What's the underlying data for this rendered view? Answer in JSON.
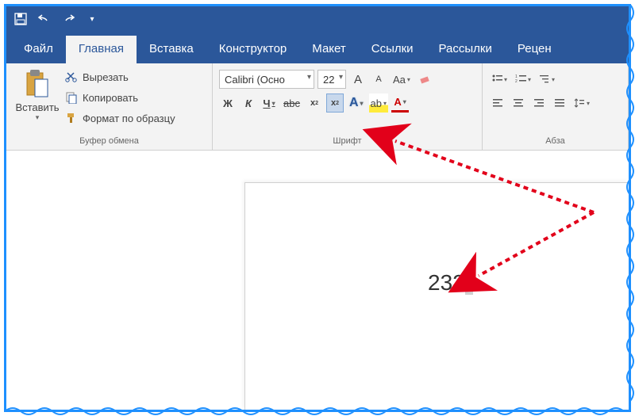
{
  "tabs": {
    "file": "Файл",
    "home": "Главная",
    "insert": "Вставка",
    "design": "Конструктор",
    "layout": "Макет",
    "references": "Ссылки",
    "mailings": "Рассылки",
    "review": "Рецен"
  },
  "clipboard": {
    "paste": "Вставить",
    "cut": "Вырезать",
    "copy": "Копировать",
    "format_painter": "Формат по образцу",
    "group_label": "Буфер обмена"
  },
  "font": {
    "name": "Calibri (Осно",
    "size": "22",
    "bold": "Ж",
    "italic": "К",
    "underline": "Ч",
    "strike": "abc",
    "subscript": "x",
    "superscript": "x",
    "text_effects": "A",
    "highlight": "ab",
    "font_color": "A",
    "grow": "A",
    "shrink": "A",
    "case": "Aa",
    "group_label": "Шрифт"
  },
  "paragraph": {
    "group_label": "Абза"
  },
  "document": {
    "text": "232"
  }
}
